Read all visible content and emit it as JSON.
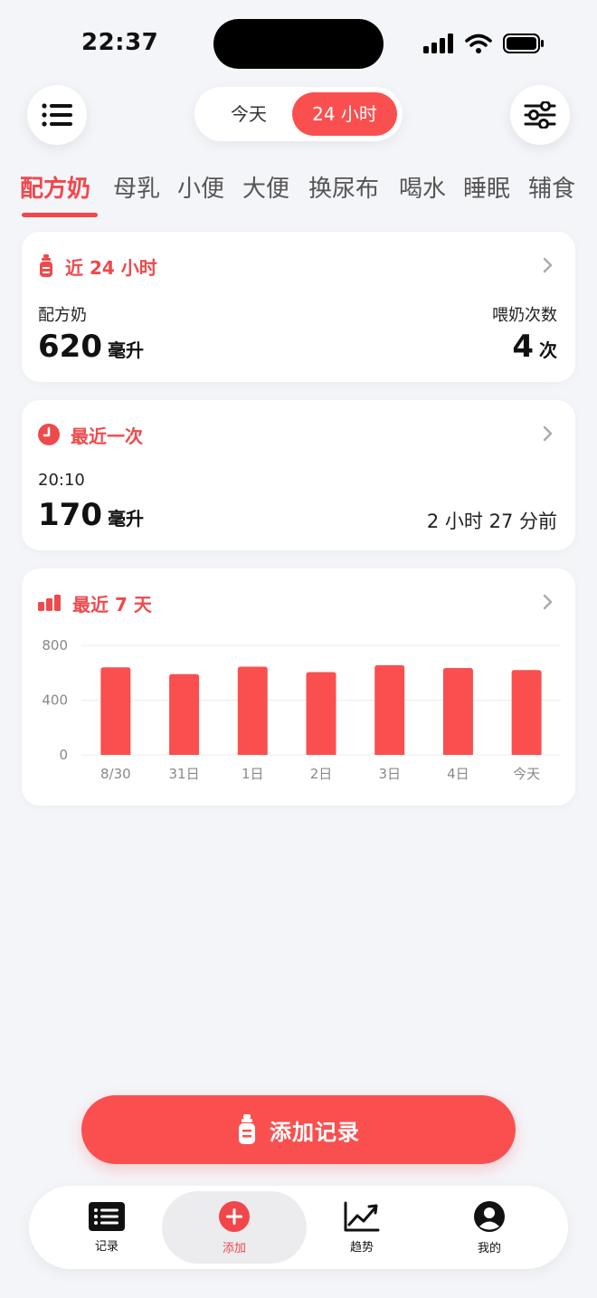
{
  "status_bar": {
    "time": "22:37"
  },
  "header": {
    "segments": [
      {
        "label": "今天",
        "selected": false
      },
      {
        "label": "24 小时",
        "selected": true
      }
    ]
  },
  "tabs": [
    "配方奶",
    "母乳",
    "小便",
    "大便",
    "换尿布",
    "喝水",
    "睡眠",
    "辅食"
  ],
  "active_tab": "配方奶",
  "summary_card": {
    "title": "近 24 小时",
    "left_label": "配方奶",
    "left_value": "620",
    "left_unit": "毫升",
    "right_label": "喂奶次数",
    "right_value": "4",
    "right_unit": "次"
  },
  "last_card": {
    "title": "最近一次",
    "time": "20:10",
    "value": "170",
    "unit": "毫升",
    "relative": "2 小时 27 分前"
  },
  "week_card": {
    "title": "最近 7 天"
  },
  "chart_data": {
    "type": "bar",
    "categories": [
      "8/30",
      "31日",
      "1日",
      "2日",
      "3日",
      "4日",
      "今天"
    ],
    "values": [
      640,
      590,
      645,
      605,
      655,
      635,
      620
    ],
    "ylim": [
      0,
      800
    ],
    "yticks": [
      "0",
      "400",
      "800"
    ],
    "grid": true,
    "color": "#f9504f",
    "highlight_last_label_color": "#ee4a4b"
  },
  "add_button": {
    "label": "添加记录"
  },
  "bottom_nav": [
    {
      "label": "记录",
      "icon": "list-icon",
      "active": false
    },
    {
      "label": "添加",
      "icon": "plus-circle-icon",
      "active": true
    },
    {
      "label": "趋势",
      "icon": "trend-icon",
      "active": false
    },
    {
      "label": "我的",
      "icon": "profile-icon",
      "active": false
    }
  ],
  "colors": {
    "accent": "#f9504f",
    "accent_text": "#ee4a4b",
    "background": "#f4f5f9"
  }
}
